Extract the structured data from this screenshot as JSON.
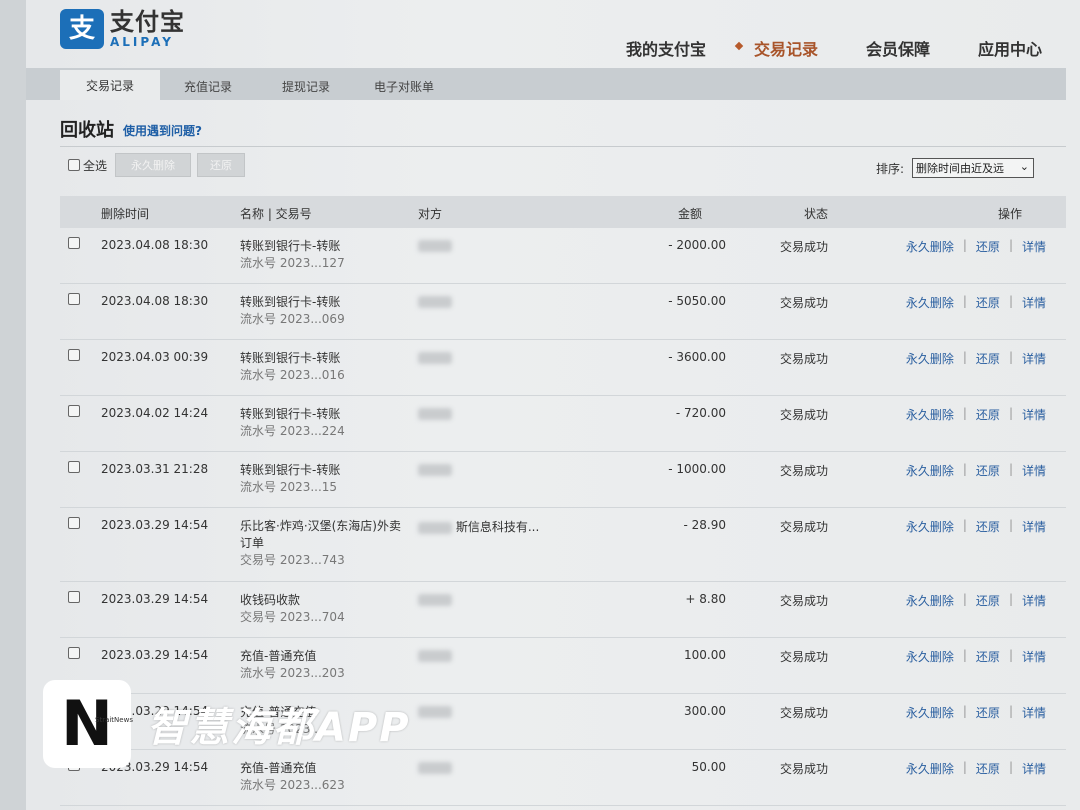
{
  "header": {
    "logo_cn": "支付宝",
    "logo_en": "ALIPAY",
    "logo_glyph": "支",
    "nav": [
      {
        "label": "我的支付宝",
        "active": false
      },
      {
        "label": "交易记录",
        "active": true
      },
      {
        "label": "会员保障",
        "active": false
      },
      {
        "label": "应用中心",
        "active": false
      }
    ]
  },
  "subtabs": [
    {
      "label": "交易记录",
      "active": true
    },
    {
      "label": "充值记录",
      "active": false
    },
    {
      "label": "提现记录",
      "active": false
    },
    {
      "label": "电子对账单",
      "active": false
    }
  ],
  "page": {
    "title": "回收站",
    "help_link": "使用遇到问题?"
  },
  "toolbar": {
    "select_all": "全选",
    "delete_button": "永久删除",
    "restore_button": "还原",
    "sort_label": "排序:",
    "sort_value": "删除时间由近及远"
  },
  "table": {
    "headers": {
      "time": "删除时间",
      "name": "名称 | 交易号",
      "party": "对方",
      "amount": "金额",
      "status": "状态",
      "ops": "操作"
    },
    "ops": {
      "delete": "永久删除",
      "restore": "还原",
      "detail": "详情"
    },
    "rows": [
      {
        "time": "2023.04.08 18:30",
        "name": "转账到银行卡-转账",
        "sub": "流水号 2023...127",
        "party": "",
        "amount": "- 2000.00",
        "status": "交易成功"
      },
      {
        "time": "2023.04.08 18:30",
        "name": "转账到银行卡-转账",
        "sub": "流水号 2023...069",
        "party": "",
        "amount": "- 5050.00",
        "status": "交易成功"
      },
      {
        "time": "2023.04.03 00:39",
        "name": "转账到银行卡-转账",
        "sub": "流水号 2023...016",
        "party": "",
        "amount": "- 3600.00",
        "status": "交易成功"
      },
      {
        "time": "2023.04.02 14:24",
        "name": "转账到银行卡-转账",
        "sub": "流水号 2023...224",
        "party": "",
        "amount": "- 720.00",
        "status": "交易成功"
      },
      {
        "time": "2023.03.31 21:28",
        "name": "转账到银行卡-转账",
        "sub": "流水号 2023...15",
        "party": "",
        "amount": "- 1000.00",
        "status": "交易成功"
      },
      {
        "time": "2023.03.29 14:54",
        "name": "乐比客·炸鸡·汉堡(东海店)外卖订单",
        "sub": "交易号 2023...743",
        "party": "斯信息科技有...",
        "amount": "- 28.90",
        "status": "交易成功",
        "tall": true
      },
      {
        "time": "2023.03.29 14:54",
        "name": "收钱码收款",
        "sub": "交易号 2023...704",
        "party": "",
        "amount": "+ 8.80",
        "status": "交易成功"
      },
      {
        "time": "2023.03.29 14:54",
        "name": "充值-普通充值",
        "sub": "流水号 2023...203",
        "party": "",
        "amount": "100.00",
        "status": "交易成功"
      },
      {
        "time": "2023.03.29 14:54",
        "name": "充值-普通充值",
        "sub": "流水号 2023...",
        "party": "",
        "amount": "300.00",
        "status": "交易成功"
      },
      {
        "time": "2023.03.29 14:54",
        "name": "充值-普通充值",
        "sub": "流水号 2023...623",
        "party": "",
        "amount": "50.00",
        "status": "交易成功"
      }
    ]
  },
  "watermark": {
    "badge_letter": "N",
    "badge_small": "StraitNews",
    "text": "智慧海都APP"
  },
  "colors": {
    "brand_blue": "#1c6fb8",
    "active_nav": "#a8542a",
    "link_blue": "#2a5fa0"
  }
}
